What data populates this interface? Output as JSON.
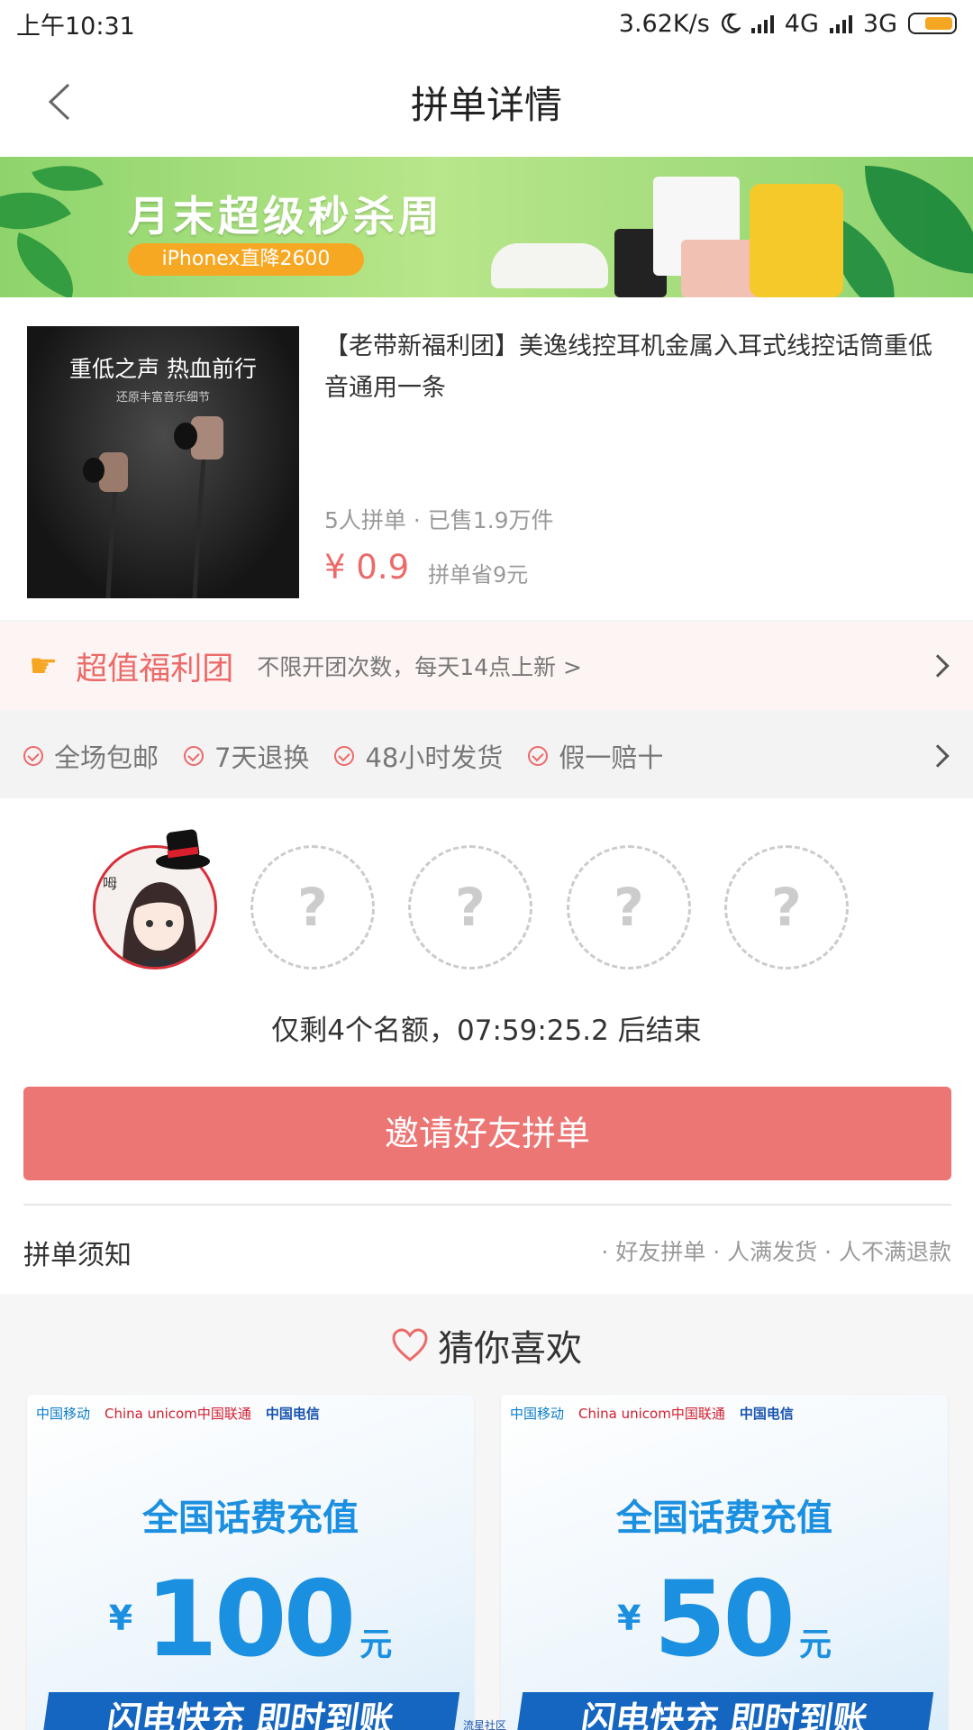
{
  "status_bar": {
    "time": "上午10:31",
    "speed": "3.62K/s",
    "network1": "4G",
    "network2": "3G"
  },
  "nav": {
    "title": "拼单详情"
  },
  "banner": {
    "title": "月末超级秒杀周",
    "subtitle": "iPhonex直降2600"
  },
  "product": {
    "image_line1": "重低之声 热血前行",
    "image_line2": "还原丰富音乐细节",
    "title": "【老带新福利团】美逸线控耳机金属入耳式线控话筒重低音通用一条",
    "sales": "5人拼单 · 已售1.9万件",
    "price": "¥ 0.9",
    "saving": "拼单省9元"
  },
  "welfare": {
    "name": "超值福利团",
    "desc": "不限开团次数，每天14点上新 >"
  },
  "guarantees": [
    {
      "label": "全场包邮"
    },
    {
      "label": "7天退换"
    },
    {
      "label": "48小时发货"
    },
    {
      "label": "假一赔十"
    }
  ],
  "group": {
    "avatar_text": "呣",
    "slot_mark": "?",
    "remaining": "仅剩4个名额，07:59:25.2  后结束",
    "invite_label": "邀请好友拼单",
    "notice_label": "拼单须知",
    "notice_tags": "· 好友拼单 · 人满发货 · 人不满退款"
  },
  "guess": {
    "title": "猜你喜欢",
    "cards": [
      {
        "carrier1": "中国移动",
        "carrier2": "China unicom中国联通",
        "carrier3": "中国电信",
        "title": "全国话费充值",
        "currency": "¥",
        "amount": "100",
        "unit": "元",
        "ribbon": "闪电快充  即时到账"
      },
      {
        "carrier1": "中国移动",
        "carrier2": "China unicom中国联通",
        "carrier3": "中国电信",
        "title": "全国话费充值",
        "currency": "¥",
        "amount": "50",
        "unit": "元",
        "ribbon": "闪电快充  即时到账"
      }
    ]
  },
  "watermark": "流星社区",
  "colors": {
    "accent": "#ec6a6a",
    "invite_button": "#ec7674",
    "banner_green": "#8ed46b",
    "recharge_blue": "#1b8fe0"
  },
  "icons": {
    "back": "chevron-left-icon",
    "moon": "moon-icon",
    "signal": "signal-icon",
    "battery": "battery-icon",
    "hand": "pointing-hand-icon",
    "check": "check-circle-icon",
    "chevron": "chevron-right-icon",
    "heart": "heart-outline-icon"
  }
}
